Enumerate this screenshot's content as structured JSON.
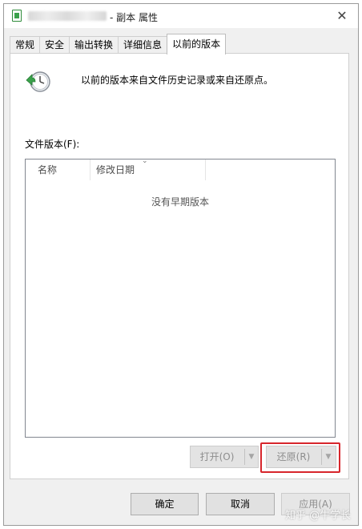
{
  "window": {
    "title": "- 副本 属性",
    "close_glyph": "✕"
  },
  "tabs": [
    {
      "label": "常规",
      "active": false
    },
    {
      "label": "安全",
      "active": false
    },
    {
      "label": "输出转换",
      "active": false
    },
    {
      "label": "详细信息",
      "active": false
    },
    {
      "label": "以前的版本",
      "active": true
    }
  ],
  "panel": {
    "description": "以前的版本来自文件历史记录或来自还原点。",
    "versions_label": "文件版本(F):",
    "columns": [
      "名称",
      "修改日期"
    ],
    "empty_message": "没有早期版本",
    "sort_glyph": "⌄"
  },
  "actions": {
    "open_label": "打开(O)",
    "restore_label": "还原(R)",
    "dropdown_glyph": "▼"
  },
  "footer": {
    "ok_label": "确定",
    "cancel_label": "取消",
    "apply_label": "应用(A)"
  },
  "watermark": "知乎 @牛学长",
  "colors": {
    "highlight": "#d7262c",
    "disabled_text": "#8e8e8e",
    "icon_green": "#3aa14b"
  },
  "icons": {
    "title_icon": "document-green-icon",
    "panel_icon": "clock-restore-icon",
    "close": "close-icon"
  }
}
